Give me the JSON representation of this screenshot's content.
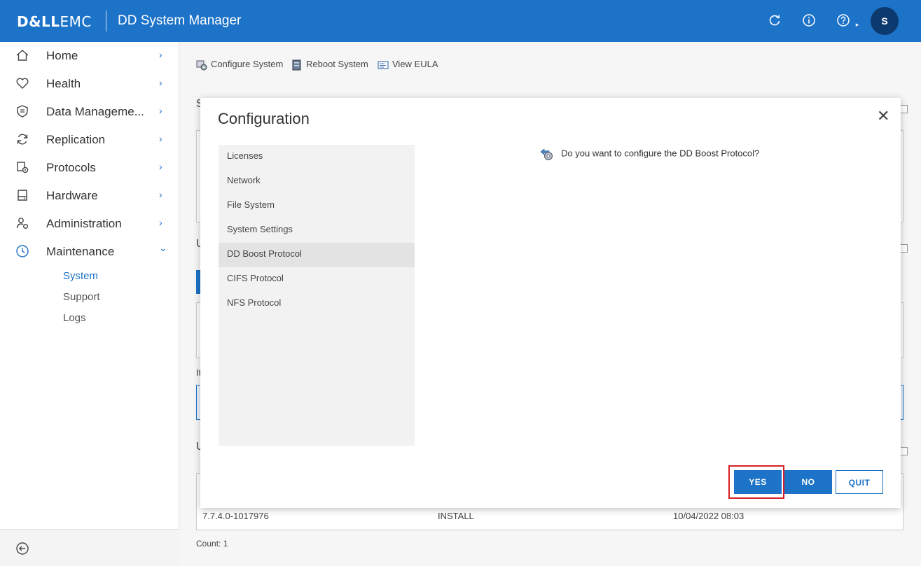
{
  "header": {
    "brand_dell": "D&LL",
    "brand_emc": "EMC",
    "app_title": "DD System Manager",
    "help_caret": "▸",
    "avatar_initial": "S",
    "brand_color": "#1d73c8"
  },
  "sidebar": {
    "items": [
      {
        "label": "Home",
        "icon": "home-icon"
      },
      {
        "label": "Health",
        "icon": "heart-icon"
      },
      {
        "label": "Data Manageme...",
        "icon": "shield-icon"
      },
      {
        "label": "Replication",
        "icon": "sync-icon"
      },
      {
        "label": "Protocols",
        "icon": "protocols-gear-icon"
      },
      {
        "label": "Hardware",
        "icon": "drive-icon"
      },
      {
        "label": "Administration",
        "icon": "user-gear-icon"
      },
      {
        "label": "Maintenance",
        "icon": "clock-gear-icon"
      }
    ],
    "chevron_right": "›",
    "chevron_down": "⌄",
    "sub_items": [
      "System",
      "Support",
      "Logs"
    ],
    "active_sub": "System"
  },
  "toolbar": {
    "configure": "Configure System",
    "reboot": "Reboot System",
    "eula": "View EULA"
  },
  "background": {
    "row_version": "7.7.4.0-1017976",
    "row_action": "INSTALL",
    "row_date": "10/04/2022 08:03",
    "count": "Count: 1",
    "label_s": "S",
    "label_u1": "U",
    "label_it": "It",
    "label_u2": "U"
  },
  "modal": {
    "title": "Configuration",
    "close": "✕",
    "steps": [
      "Licenses",
      "Network",
      "File System",
      "System Settings",
      "DD Boost Protocol",
      "CIFS Protocol",
      "NFS Protocol"
    ],
    "active_step": "DD Boost Protocol",
    "question": "Do you want to configure the DD Boost Protocol?",
    "yes": "YES",
    "no": "NO",
    "quit": "QUIT"
  }
}
